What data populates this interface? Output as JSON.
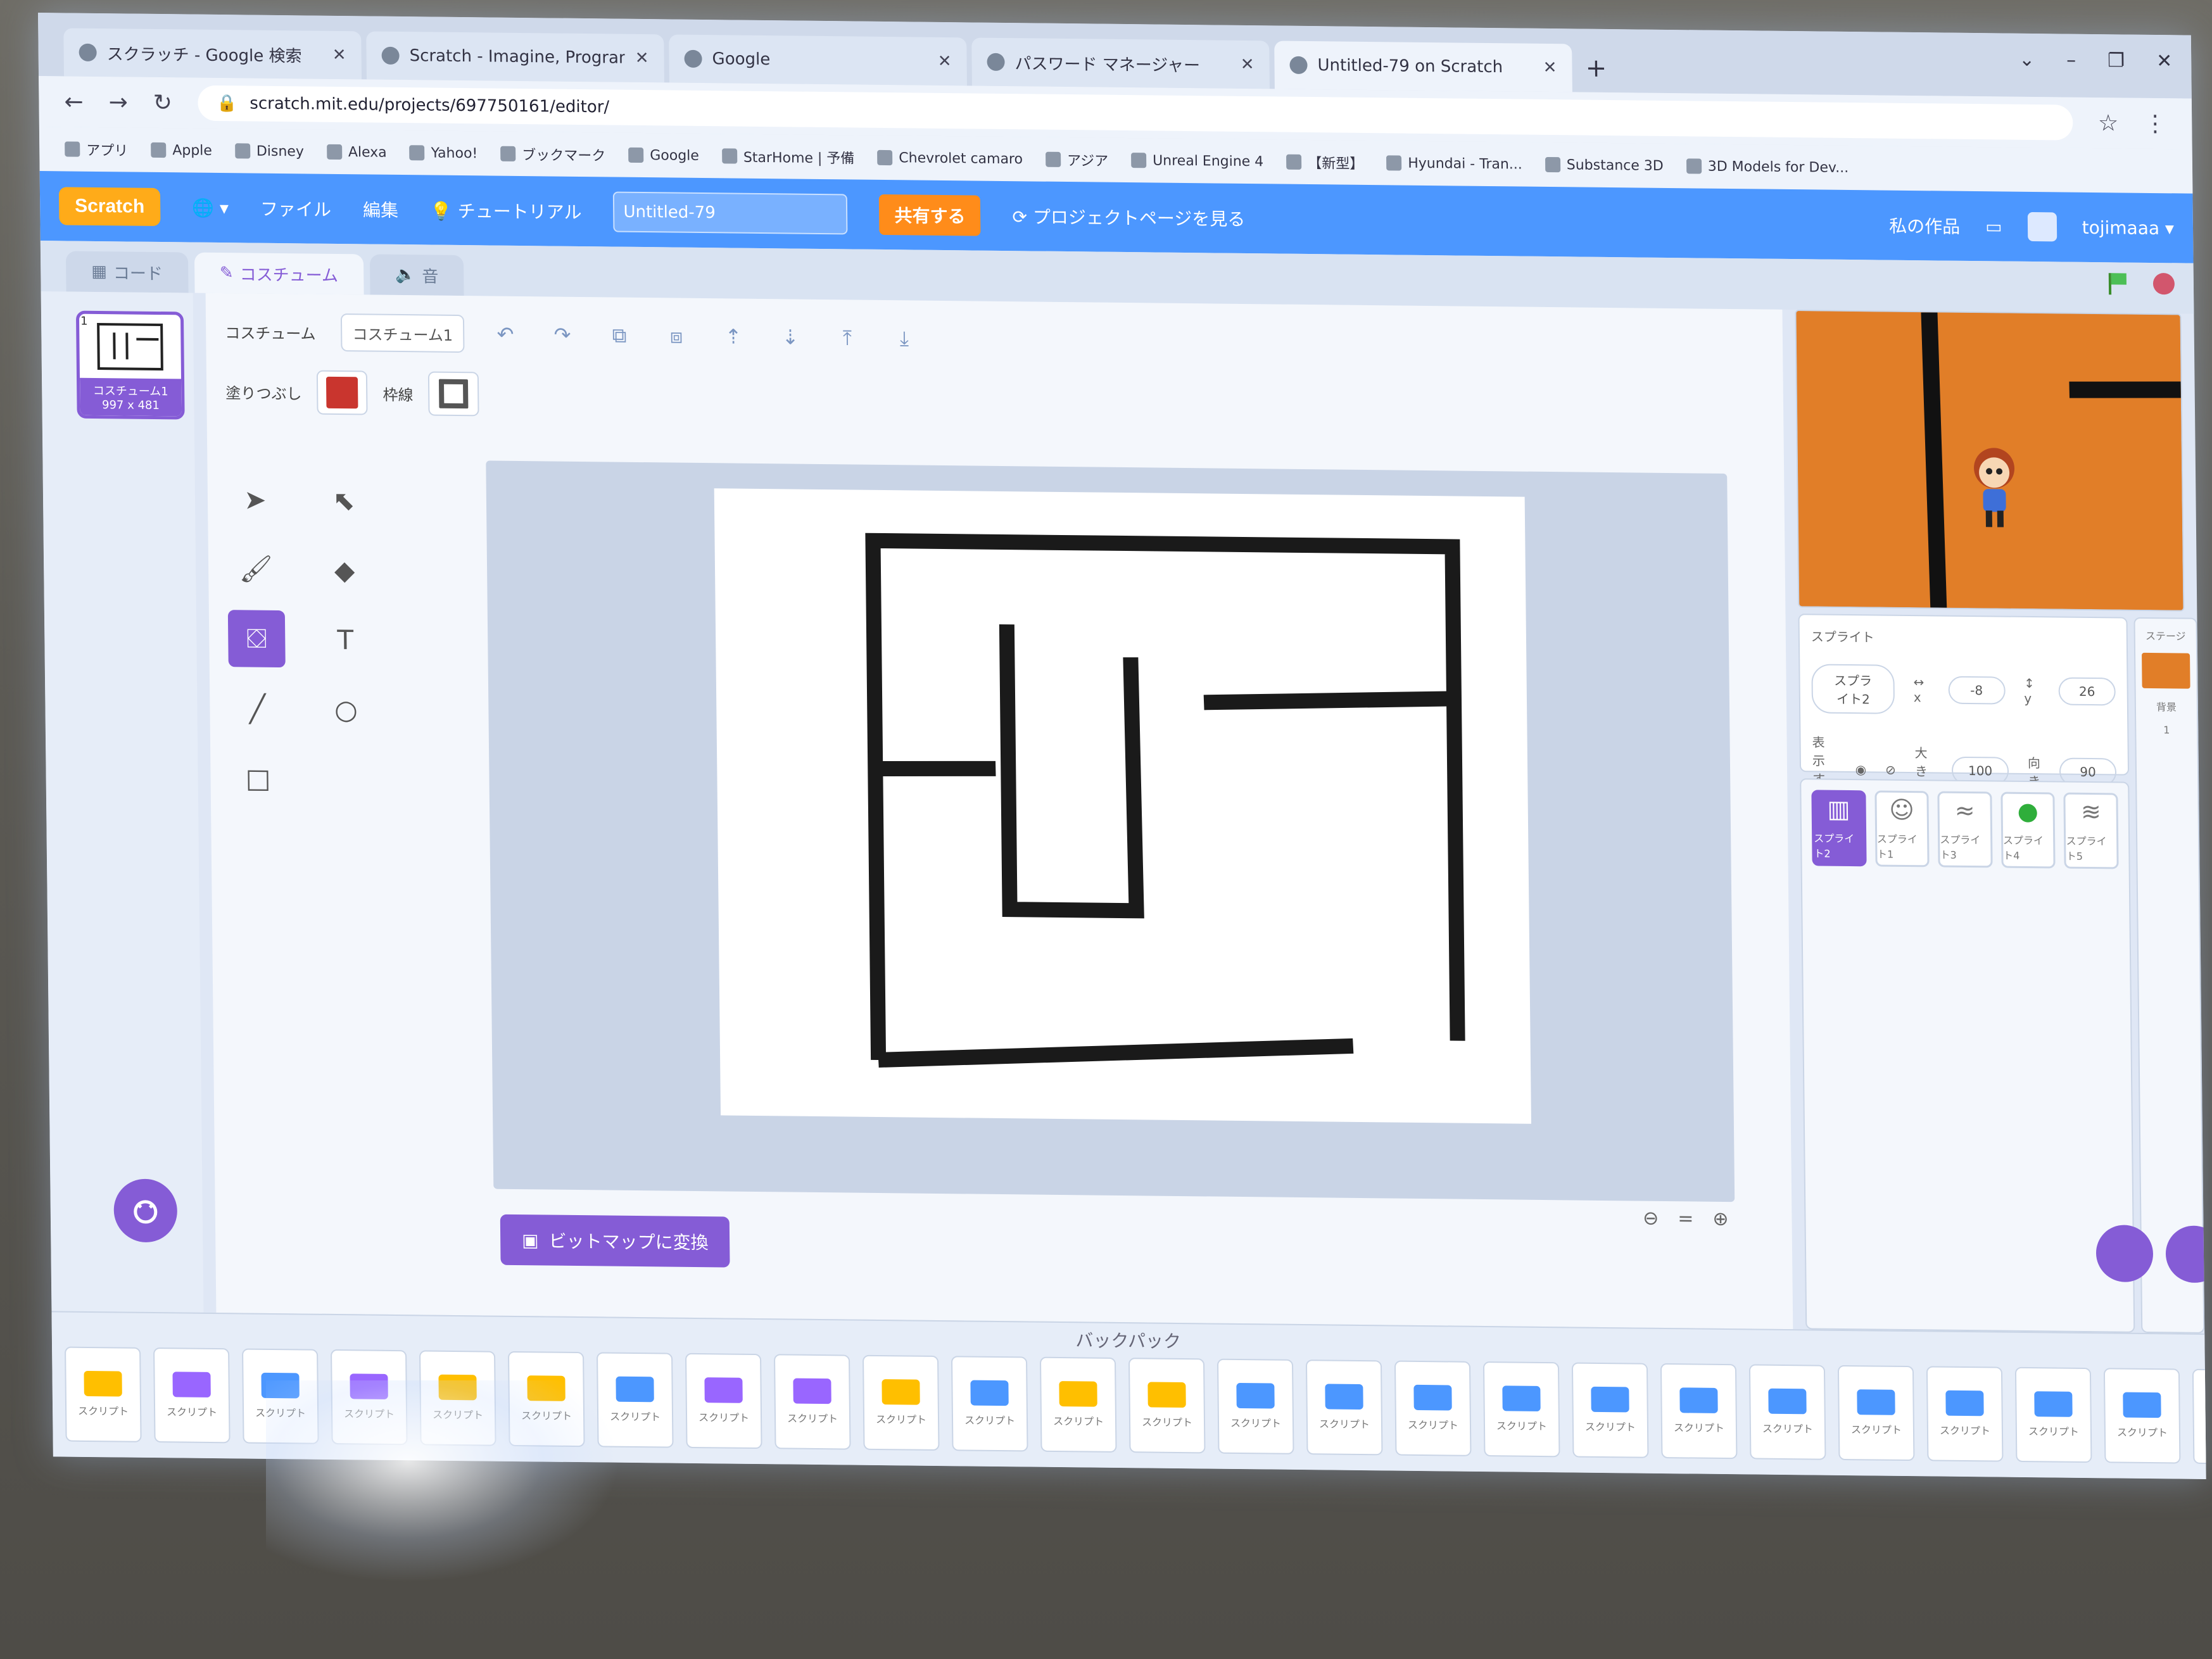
{
  "browser": {
    "tabs": [
      {
        "title": "スクラッチ - Google 検索"
      },
      {
        "title": "Scratch - Imagine, Program, Share"
      },
      {
        "title": "Google"
      },
      {
        "title": "パスワード マネージャー"
      },
      {
        "title": "Untitled-79 on Scratch"
      }
    ],
    "url": "scratch.mit.edu/projects/697750161/editor/",
    "bookmarks": [
      "アプリ",
      "Apple",
      "Disney",
      "Alexa",
      "Yahoo!",
      "ブックマーク",
      "Google",
      "StarHome | 予備",
      "Chevrolet camaro",
      "アジア",
      "Unreal Engine 4",
      "【新型】",
      "Hyundai - Tran...",
      "Substance 3D",
      "3D Models for Dev..."
    ]
  },
  "menubar": {
    "logo": "Scratch",
    "file": "ファイル",
    "edit": "編集",
    "tutorial": "チュートリアル",
    "project_title": "Untitled-79",
    "share": "共有する",
    "project_page": "プロジェクトページを見る",
    "my_stuff": "私の作品",
    "account": "tojimaaa"
  },
  "editor_tabs": {
    "code": "コード",
    "costumes": "コスチューム",
    "sounds": "音"
  },
  "costume_list": {
    "index": "1",
    "name": "コスチューム1",
    "size": "997 x 481"
  },
  "paint": {
    "costume_label": "コスチューム",
    "costume_name": "コスチューム1",
    "fill_label": "塗りつぶし",
    "outline_label": "枠線",
    "convert_bitmap": "ビットマップに変換",
    "fill_color": "#c9352e"
  },
  "sprite_info": {
    "sprite_label": "スプライト",
    "sprite_name": "スプライト2",
    "x": "-8",
    "y": "26",
    "show_label": "表示する",
    "size_label": "大きさ",
    "size": "100",
    "direction_label": "向き",
    "direction": "90"
  },
  "sprites": [
    {
      "label": "スプライト2",
      "selected": true,
      "icon": "maze-icon"
    },
    {
      "label": "スプライト1",
      "selected": false,
      "icon": "character-icon"
    },
    {
      "label": "スプライト3",
      "selected": false,
      "icon": "text-icon"
    },
    {
      "label": "スプライト4",
      "selected": false,
      "icon": "green-dot-icon"
    },
    {
      "label": "スプライト5",
      "selected": false,
      "icon": "goal-text-icon"
    }
  ],
  "stage_pane": {
    "label": "ステージ",
    "backdrops_label": "背景",
    "backdrops_count": "1"
  },
  "backpack": {
    "title": "バックパック",
    "item_label": "スクリプト"
  },
  "colors": {
    "scratch_blue": "#4c97ff",
    "scratch_purple": "#855cd6",
    "stage_orange": "#e17e28"
  }
}
